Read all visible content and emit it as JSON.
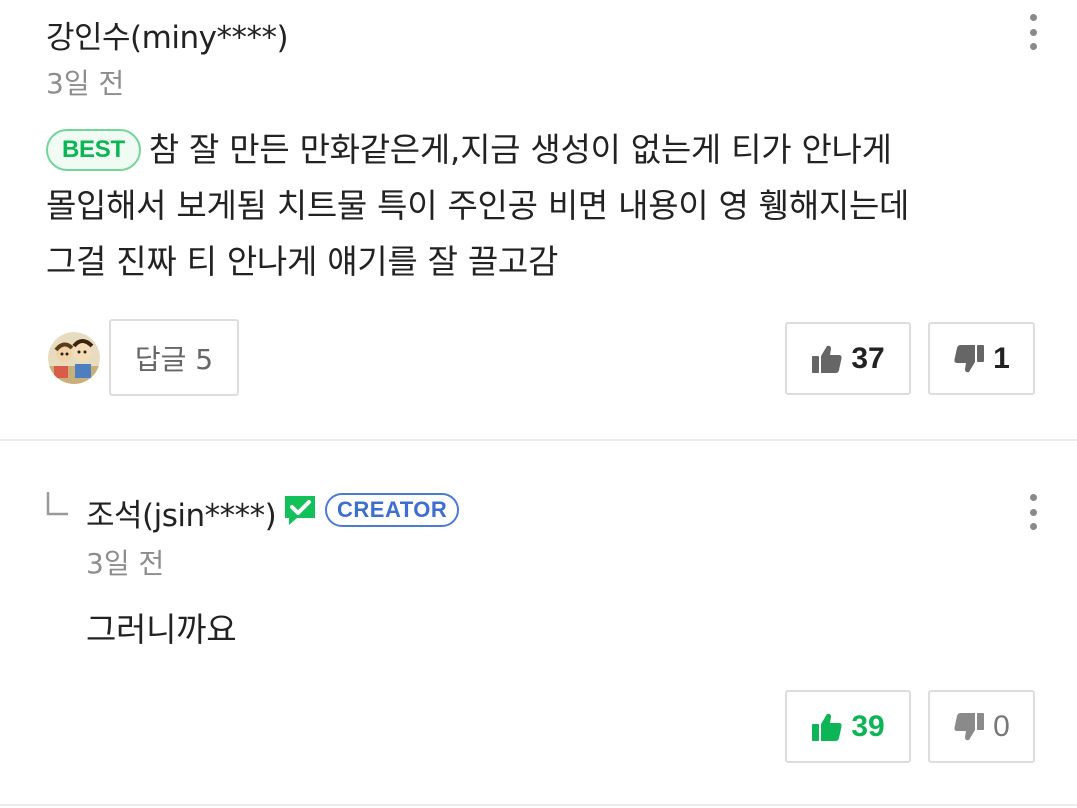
{
  "comment": {
    "author": "강인수(miny****)",
    "time": "3일 전",
    "badge": "BEST",
    "text_lines": [
      "참 잘 만든 만화같은게,지금 생성이 없는게 티가 안나게",
      "몰입해서 보게됨 치트물 특이 주인공 비면 내용이 영 휑해지는데",
      "그걸 진짜 티 안나게 얘기를 잘 끌고감"
    ],
    "reply_button": "답글 5",
    "likes": "37",
    "dislikes": "1",
    "colors": {
      "best_green": "#0cb555"
    }
  },
  "reply": {
    "author": "조석(jsin****)",
    "verified_icon": "check-message-icon",
    "creator_badge": "CREATOR",
    "time": "3일 전",
    "text": "그러니까요",
    "likes": "39",
    "dislikes": "0",
    "colors": {
      "creator_blue": "#3d6fd1",
      "liked_green": "#0cb555"
    }
  },
  "icons": {
    "more": "vertical-ellipsis-icon",
    "like": "thumbs-up-icon",
    "dislike": "thumbs-down-icon",
    "reply_marker": "reply-corner-icon"
  }
}
